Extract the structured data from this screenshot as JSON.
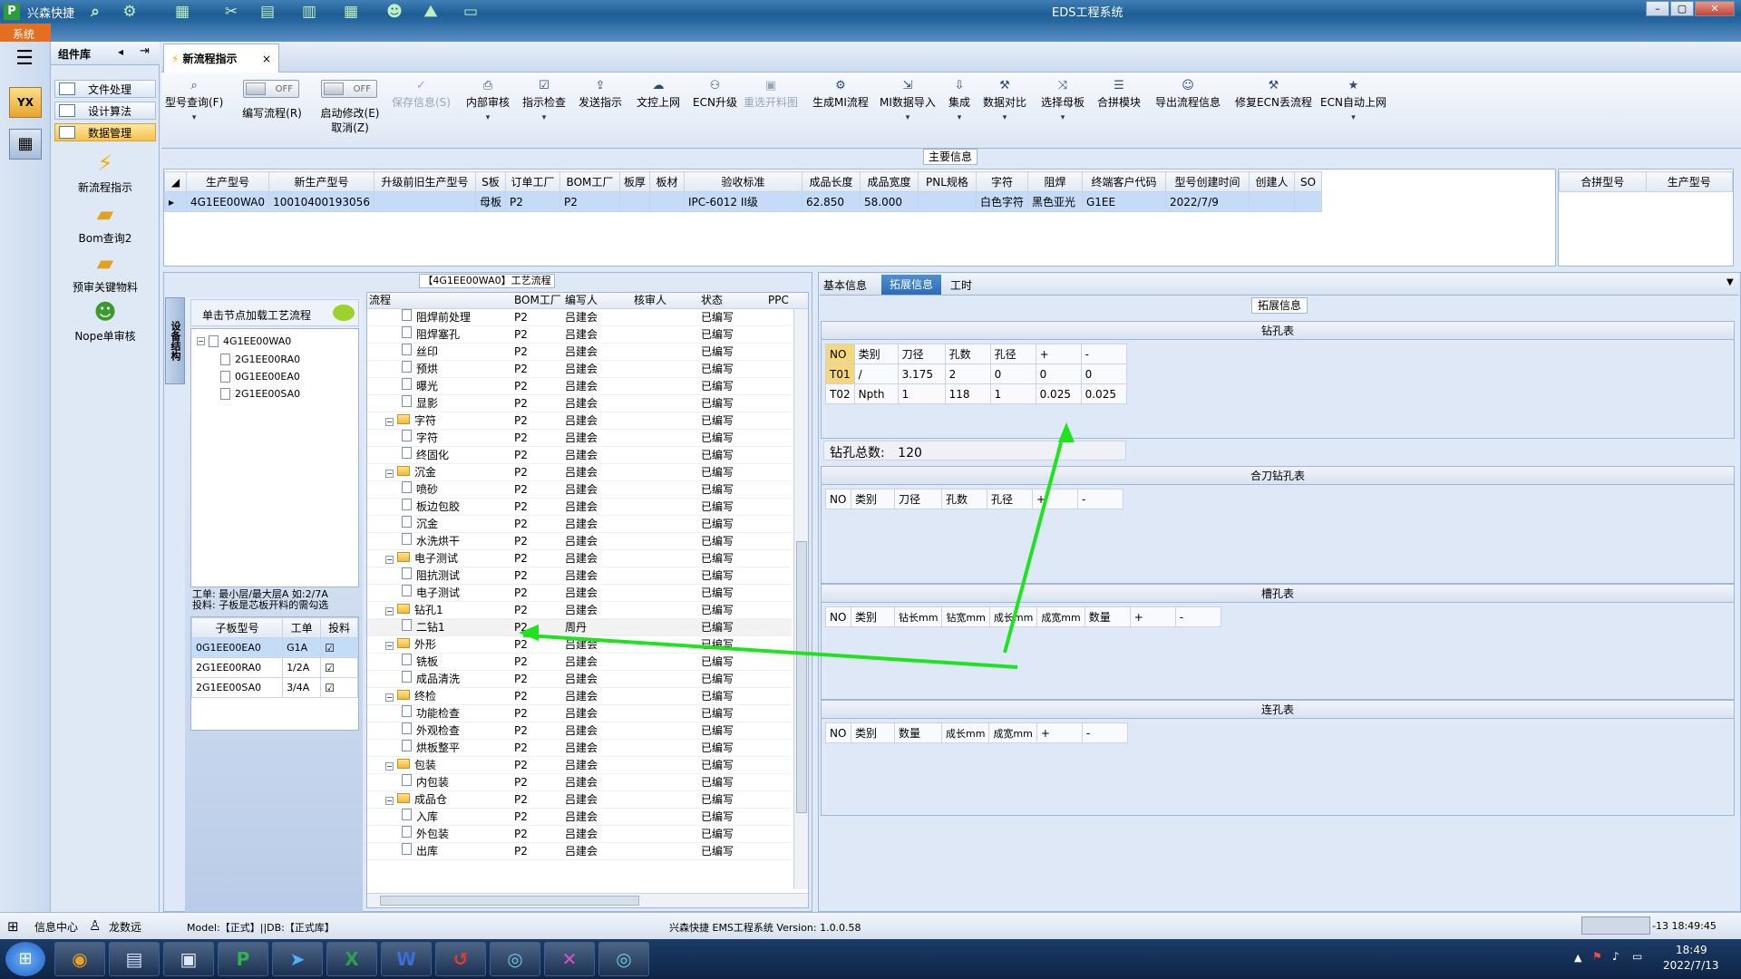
{
  "window": {
    "app_name": "兴森快捷",
    "title": "EDS工程系统",
    "controls": [
      "–",
      "▢",
      "✕"
    ]
  },
  "systab": "系统",
  "components": {
    "title": "组件库",
    "menu": [
      "文件处理",
      "设计算法",
      "数据管理"
    ],
    "actions": [
      "新流程指示",
      "Bom查询2",
      "预审关键物料",
      "Nope单审核"
    ]
  },
  "doctab": {
    "label": "新流程指示",
    "close": "×"
  },
  "ribbon": {
    "buttons": [
      {
        "label": "型号查询(F)",
        "icon": "search-icon"
      },
      {
        "label": "保存信息(S)",
        "icon": "check-icon",
        "disabled": true
      },
      {
        "label": "内部审核",
        "icon": "print-icon"
      },
      {
        "label": "指示检查",
        "icon": "check-icon"
      },
      {
        "label": "发送指示",
        "icon": "upload-icon"
      },
      {
        "label": "文控上网",
        "icon": "cloud-icon"
      },
      {
        "label": "ECN升级",
        "icon": "people-icon"
      },
      {
        "label": "重选开料图",
        "icon": "image-icon",
        "disabled": true
      },
      {
        "label": "生成MI流程",
        "icon": "gear-icon"
      },
      {
        "label": "MI数据导入",
        "icon": "import-icon"
      },
      {
        "label": "集成",
        "icon": "download-icon"
      },
      {
        "label": "数据对比",
        "icon": "tools-icon"
      },
      {
        "label": "选择母板",
        "icon": "shuffle-icon"
      },
      {
        "label": "合拼模块",
        "icon": "list-icon"
      },
      {
        "label": "导出流程信息",
        "icon": "smile-icon"
      },
      {
        "label": "修复ECN丢流程",
        "icon": "wrench-icon"
      },
      {
        "label": "ECN自动上网",
        "icon": "star-icon"
      }
    ],
    "toggle1": {
      "state": "OFF",
      "label": "编写流程(R)"
    },
    "toggle2": {
      "state": "OFF",
      "label": "启动修改(E)",
      "sub": "取消(Z)"
    }
  },
  "main_info": {
    "title": "主要信息",
    "columns": [
      "生产型号",
      "新生产型号",
      "升级前旧生产型号",
      "S板",
      "订单工厂",
      "BOM工厂",
      "板厚",
      "板材",
      "验收标准",
      "成品长度",
      "成品宽度",
      "PNL规格",
      "字符",
      "阻焊",
      "终端客户代码",
      "型号创建时间",
      "创建人",
      "SO"
    ],
    "row": [
      "4G1EE00WA0",
      "10010400193056",
      "",
      "母板",
      "P2",
      "P2",
      "",
      "",
      "IPC-6012 II级",
      "62.850",
      "58.000",
      "",
      "白色字符",
      "黑色亚光",
      "G1EE",
      "2022/7/9",
      "",
      ""
    ],
    "right_columns": [
      "合拼型号",
      "生产型号"
    ]
  },
  "flow_panel": {
    "title": "【4G1EE00WA0】工艺流程",
    "vertical_tab": "设备结构",
    "load_hint": "单击节点加载工艺流程",
    "tree": {
      "root": "4G1EE00WA0",
      "children": [
        "2G1EE00RA0",
        "0G1EE00EA0",
        "2G1EE00SA0"
      ]
    },
    "note_lines": [
      "工单: 最小层/最大层A 如:2/7A",
      "投料: 子板是芯板开料的需勾选"
    ],
    "sub_columns": [
      "子板型号",
      "工单",
      "投料"
    ],
    "sub_rows": [
      [
        "0G1EE00EA0",
        "G1A"
      ],
      [
        "2G1EE00RA0",
        "1/2A"
      ],
      [
        "2G1EE00SA0",
        "3/4A"
      ]
    ]
  },
  "flow_grid": {
    "columns": [
      "流程",
      "BOM工厂",
      "编写人",
      "核审人",
      "状态",
      "PPC"
    ],
    "rows": [
      {
        "name": "阻焊前处理",
        "folder": false,
        "factory": "P2",
        "writer": "吕建会",
        "status": "已编写"
      },
      {
        "name": "阻焊塞孔",
        "folder": false,
        "factory": "P2",
        "writer": "吕建会",
        "status": "已编写"
      },
      {
        "name": "丝印",
        "folder": false,
        "factory": "P2",
        "writer": "吕建会",
        "status": "已编写"
      },
      {
        "name": "预烘",
        "folder": false,
        "factory": "P2",
        "writer": "吕建会",
        "status": "已编写"
      },
      {
        "name": "曝光",
        "folder": false,
        "factory": "P2",
        "writer": "吕建会",
        "status": "已编写"
      },
      {
        "name": "显影",
        "folder": false,
        "factory": "P2",
        "writer": "吕建会",
        "status": "已编写"
      },
      {
        "name": "字符",
        "folder": true,
        "factory": "P2",
        "writer": "吕建会",
        "status": "已编写"
      },
      {
        "name": "字符",
        "folder": false,
        "factory": "P2",
        "writer": "吕建会",
        "status": "已编写"
      },
      {
        "name": "终固化",
        "folder": false,
        "factory": "P2",
        "writer": "吕建会",
        "status": "已编写"
      },
      {
        "name": "沉金",
        "folder": true,
        "factory": "P2",
        "writer": "吕建会",
        "status": "已编写"
      },
      {
        "name": "喷砂",
        "folder": false,
        "factory": "P2",
        "writer": "吕建会",
        "status": "已编写"
      },
      {
        "name": "板边包胶",
        "folder": false,
        "factory": "P2",
        "writer": "吕建会",
        "status": "已编写"
      },
      {
        "name": "沉金",
        "folder": false,
        "factory": "P2",
        "writer": "吕建会",
        "status": "已编写"
      },
      {
        "name": "水洗烘干",
        "folder": false,
        "factory": "P2",
        "writer": "吕建会",
        "status": "已编写"
      },
      {
        "name": "电子测试",
        "folder": true,
        "factory": "P2",
        "writer": "吕建会",
        "status": "已编写"
      },
      {
        "name": "阻抗测试",
        "folder": false,
        "factory": "P2",
        "writer": "吕建会",
        "status": "已编写"
      },
      {
        "name": "电子测试",
        "folder": false,
        "factory": "P2",
        "writer": "吕建会",
        "status": "已编写"
      },
      {
        "name": "钻孔1",
        "folder": true,
        "factory": "P2",
        "writer": "吕建会",
        "status": "已编写"
      },
      {
        "name": "二钻1",
        "folder": false,
        "factory": "P2",
        "writer": "周丹",
        "status": "已编写",
        "selected": true
      },
      {
        "name": "外形",
        "folder": true,
        "factory": "P2",
        "writer": "吕建会",
        "status": "已编写"
      },
      {
        "name": "铣板",
        "folder": false,
        "factory": "P2",
        "writer": "吕建会",
        "status": "已编写"
      },
      {
        "name": "成品清洗",
        "folder": false,
        "factory": "P2",
        "writer": "吕建会",
        "status": "已编写"
      },
      {
        "name": "终检",
        "folder": true,
        "factory": "P2",
        "writer": "吕建会",
        "status": "已编写"
      },
      {
        "name": "功能检查",
        "folder": false,
        "factory": "P2",
        "writer": "吕建会",
        "status": "已编写"
      },
      {
        "name": "外观检查",
        "folder": false,
        "factory": "P2",
        "writer": "吕建会",
        "status": "已编写"
      },
      {
        "name": "烘板整平",
        "folder": false,
        "factory": "P2",
        "writer": "吕建会",
        "status": "已编写"
      },
      {
        "name": "包装",
        "folder": true,
        "factory": "P2",
        "writer": "吕建会",
        "status": "已编写"
      },
      {
        "name": "内包装",
        "folder": false,
        "factory": "P2",
        "writer": "吕建会",
        "status": "已编写"
      },
      {
        "name": "成品仓",
        "folder": true,
        "factory": "P2",
        "writer": "吕建会",
        "status": "已编写"
      },
      {
        "name": "入库",
        "folder": false,
        "factory": "P2",
        "writer": "吕建会",
        "status": "已编写"
      },
      {
        "name": "外包装",
        "folder": false,
        "factory": "P2",
        "writer": "吕建会",
        "status": "已编写"
      },
      {
        "name": "出库",
        "folder": false,
        "factory": "P2",
        "writer": "吕建会",
        "status": "已编写"
      }
    ]
  },
  "right_panel": {
    "tabs": [
      "基本信息",
      "拓展信息",
      "工时"
    ],
    "active_tab": "拓展信息",
    "section_title": "拓展信息",
    "drill": {
      "title": "钻孔表",
      "columns": [
        "NO",
        "类别",
        "刀径",
        "孔数",
        "孔径",
        "+",
        "-"
      ],
      "rows": [
        [
          "T01",
          "/",
          "3.175",
          "2",
          "0",
          "0",
          "0"
        ],
        [
          "T02",
          "Npth",
          "1",
          "118",
          "1",
          "0.025",
          "0.025"
        ]
      ],
      "total_label": "钻孔总数:",
      "total": "120"
    },
    "combo": {
      "title": "合刀钻孔表",
      "columns": [
        "NO",
        "类别",
        "刀径",
        "孔数",
        "孔径",
        "+",
        "-"
      ]
    },
    "slot": {
      "title": "槽孔表",
      "columns": [
        "NO",
        "类别",
        "钻长mm",
        "钻宽mm",
        "成长mm",
        "成宽mm",
        "数量",
        "+",
        "-"
      ]
    },
    "link": {
      "title": "连孔表",
      "columns": [
        "NO",
        "类别",
        "数量",
        "成长mm",
        "成宽mm",
        "+",
        "-"
      ]
    }
  },
  "status": {
    "info_center": "信息中心",
    "user": "龙数远",
    "model": "Model:【正式】||DB:【正式库】",
    "version": "兴森快捷 EMS工程系统 Version: 1.0.0.58",
    "datetime": "-13 18:49:45"
  },
  "taskbar": {
    "time": "18:49",
    "date": "2022/7/13"
  }
}
